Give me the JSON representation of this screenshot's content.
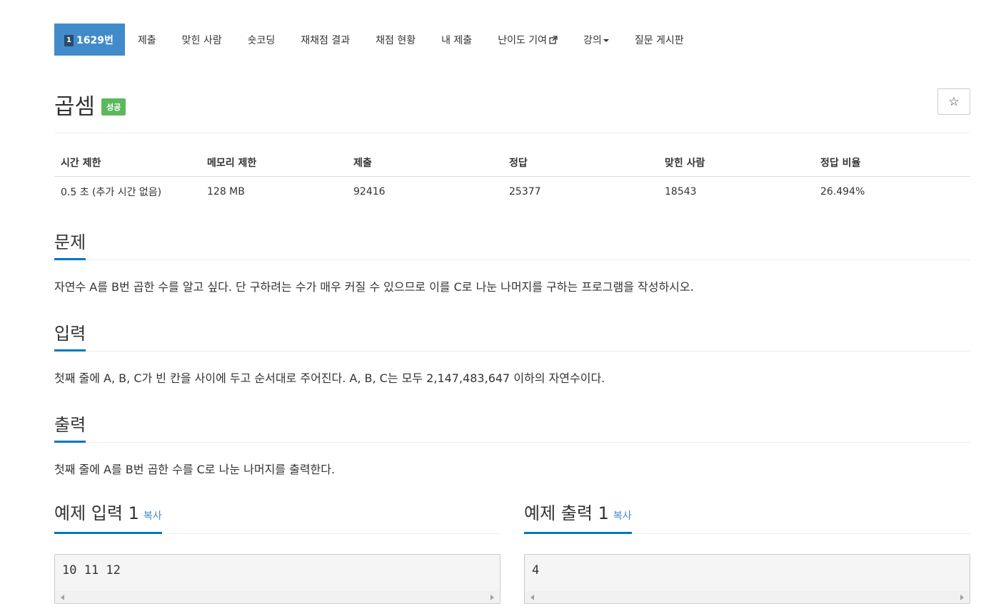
{
  "nav": {
    "problem_badge": "1",
    "problem_label": "1629번",
    "items": [
      "제출",
      "맞힌 사람",
      "숏코딩",
      "재채점 결과",
      "채점 현황",
      "내 제출",
      "난이도 기여",
      "강의",
      "질문 게시판"
    ]
  },
  "title": {
    "text": "곱셈",
    "status": "성공",
    "star": "☆"
  },
  "info": {
    "headers": [
      "시간 제한",
      "메모리 제한",
      "제출",
      "정답",
      "맞힌 사람",
      "정답 비율"
    ],
    "values": [
      "0.5 초 (추가 시간 없음)",
      "128 MB",
      "92416",
      "25377",
      "18543",
      "26.494%"
    ]
  },
  "problem": {
    "heading": "문제",
    "text": "자연수 A를 B번 곱한 수를 알고 싶다. 단 구하려는 수가 매우 커질 수 있으므로 이를 C로 나눈 나머지를 구하는 프로그램을 작성하시오."
  },
  "input": {
    "heading": "입력",
    "text": "첫째 줄에 A, B, C가 빈 칸을 사이에 두고 순서대로 주어진다. A, B, C는 모두 2,147,483,647 이하의 자연수이다."
  },
  "output": {
    "heading": "출력",
    "text": "첫째 줄에 A를 B번 곱한 수를 C로 나눈 나머지를 출력한다."
  },
  "sample_input": {
    "heading": "예제 입력 1",
    "copy": "복사",
    "content": "10 11 12"
  },
  "sample_output": {
    "heading": "예제 출력 1",
    "copy": "복사",
    "content": "4"
  },
  "colors": {
    "nav_active": "#428bca",
    "success": "#5cb85c",
    "heading_underline": "#0076c0",
    "link": "#428bca"
  }
}
